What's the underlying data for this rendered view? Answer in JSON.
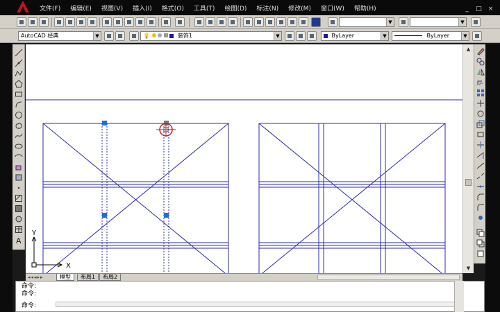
{
  "menubar": {
    "items": [
      "文件(F)",
      "编辑(E)",
      "视图(V)",
      "插入(I)",
      "格式(O)",
      "工具(T)",
      "绘图(D)",
      "标注(N)",
      "修改(M)",
      "窗口(W)",
      "帮助(H)"
    ],
    "window_controls": [
      "_",
      "□",
      "×"
    ]
  },
  "toolbar2": {
    "workspace": "AutoCAD 经典",
    "layer": "装饰1",
    "color": "ByLayer",
    "linetype": "ByLayer"
  },
  "tabs": {
    "nav": "◂◂◂▸▸",
    "items": [
      "模型",
      "布局1",
      "布局2"
    ]
  },
  "command": {
    "lines": [
      "命令:",
      "命令:",
      "命令:"
    ]
  },
  "ucs": {
    "x_label": "X",
    "y_label": "Y"
  },
  "colors": {
    "drawing_line": "#2a2ab0",
    "grip": "#1f6fd6",
    "cursor": "#c81e1e"
  }
}
